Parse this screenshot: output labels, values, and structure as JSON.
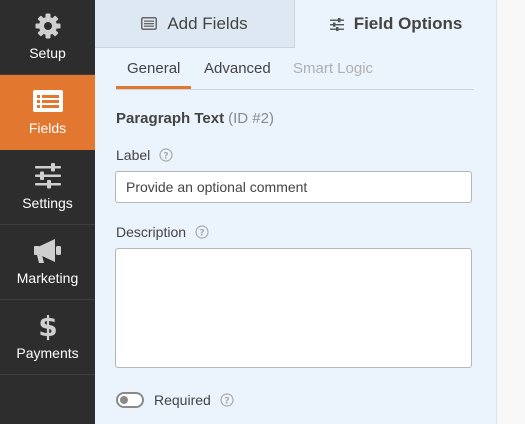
{
  "sidebar": {
    "items": [
      {
        "label": "Setup",
        "icon": "gear-icon",
        "active": false
      },
      {
        "label": "Fields",
        "icon": "fields-list-icon",
        "active": true
      },
      {
        "label": "Settings",
        "icon": "sliders-icon",
        "active": false
      },
      {
        "label": "Marketing",
        "icon": "megaphone-icon",
        "active": false
      },
      {
        "label": "Payments",
        "icon": "dollar-icon",
        "active": false
      }
    ]
  },
  "tabs": {
    "add_fields": "Add Fields",
    "field_options": "Field Options"
  },
  "subtabs": {
    "general": "General",
    "advanced": "Advanced",
    "smart_logic": "Smart Logic"
  },
  "field": {
    "type": "Paragraph Text",
    "id": "(ID #2)"
  },
  "options": {
    "label_label": "Label",
    "label_value": "Provide an optional comment",
    "description_label": "Description",
    "description_value": "",
    "required_label": "Required",
    "required_on": false
  },
  "colors": {
    "accent": "#e27730",
    "sidebar_bg": "#2d2d2d",
    "panel_bg": "#ebf3fc"
  }
}
